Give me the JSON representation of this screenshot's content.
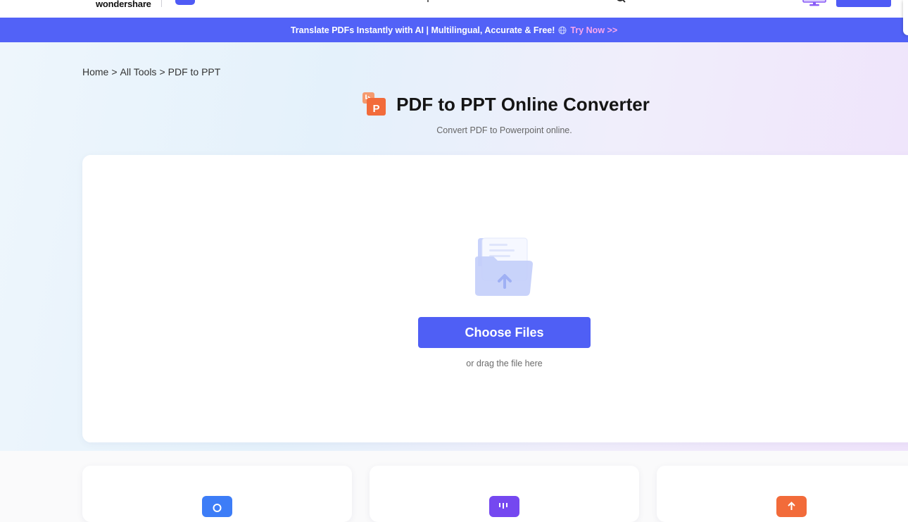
{
  "header": {
    "brand": "wondershare",
    "icons": [
      "search-icon",
      "monitor-icon"
    ]
  },
  "promo": {
    "text": "Translate PDFs Instantly with AI | Multilingual, Accurate & Free!",
    "link": "Try Now >>",
    "icon": "globe-icon"
  },
  "breadcrumb": {
    "items": [
      "Home",
      "All Tools",
      "PDF to PPT"
    ],
    "separator": ">"
  },
  "hero": {
    "title": "PDF to PPT Online Converter",
    "subtitle": "Convert PDF to Powerpoint online.",
    "tool_icon": "pdf-to-ppt-icon",
    "tool_icon_letter": "P"
  },
  "upload": {
    "button": "Choose Files",
    "hint": "or drag the file here",
    "illustration": "folder-upload-icon"
  },
  "feature_cards": [
    {
      "icon": "blue-tool-icon",
      "color": "#3d7df7"
    },
    {
      "icon": "purple-tool-icon",
      "color": "#7548f0"
    },
    {
      "icon": "orange-tool-icon",
      "color": "#f26b3a"
    }
  ],
  "colors": {
    "accent": "#4f5ff5",
    "promo_bg": "#5262f7",
    "promo_link": "#f8a6ee",
    "ppt_orange": "#f26b3a"
  }
}
